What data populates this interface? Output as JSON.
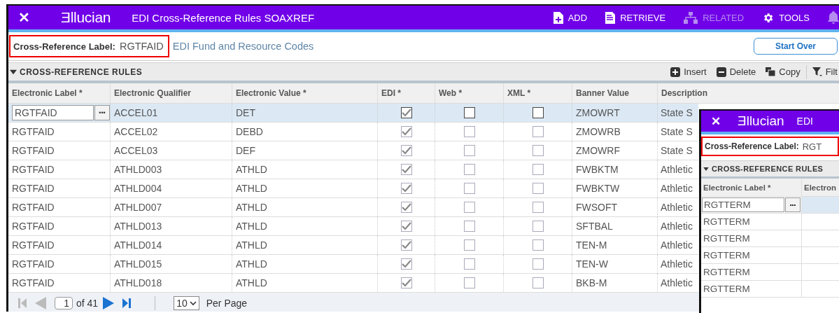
{
  "header": {
    "close": "✕",
    "logo": "Ǝllucian",
    "title": "EDI Cross-Reference Rules SOAXREF",
    "actions": [
      {
        "label": "ADD",
        "kind": "add",
        "disabled": false
      },
      {
        "label": "RETRIEVE",
        "kind": "retrieve",
        "disabled": false
      },
      {
        "label": "RELATED",
        "kind": "related",
        "disabled": true
      },
      {
        "label": "TOOLS",
        "kind": "tools",
        "disabled": false
      }
    ]
  },
  "key_block": {
    "label": "Cross-Reference Label:",
    "value": "RGTFAID",
    "description": "EDI Fund and Resource Codes",
    "start_over": "Start Over"
  },
  "section": {
    "title": "CROSS-REFERENCE RULES",
    "expanded": true,
    "tools": [
      {
        "label": "Insert",
        "kind": "insert"
      },
      {
        "label": "Delete",
        "kind": "delete"
      },
      {
        "label": "Copy",
        "kind": "copy"
      },
      {
        "label": "Filt",
        "kind": "filter"
      }
    ]
  },
  "table": {
    "columns": [
      "Electronic Label *",
      "Electronic Qualifier",
      "Electronic Value *",
      "EDI *",
      "Web *",
      "XML *",
      "Banner Value",
      "Description"
    ],
    "lookup": "•••",
    "rows": [
      {
        "selected": true,
        "label": "RGTFAID",
        "qualifier": "ACCEL01",
        "value": "DET",
        "edi": true,
        "web": false,
        "xml": false,
        "banner_value": "ZMOWRT",
        "description": "State S"
      },
      {
        "selected": false,
        "label": "RGTFAID",
        "qualifier": "ACCEL02",
        "value": "DEBD",
        "edi": true,
        "web": false,
        "xml": false,
        "banner_value": "ZMOWRB",
        "description": "State S"
      },
      {
        "selected": false,
        "label": "RGTFAID",
        "qualifier": "ACCEL03",
        "value": "DEF",
        "edi": true,
        "web": false,
        "xml": false,
        "banner_value": "ZMOWRF",
        "description": "State S"
      },
      {
        "selected": false,
        "label": "RGTFAID",
        "qualifier": "ATHLD003",
        "value": "ATHLD",
        "edi": true,
        "web": false,
        "xml": false,
        "banner_value": "FWBKTM",
        "description": "Athletic"
      },
      {
        "selected": false,
        "label": "RGTFAID",
        "qualifier": "ATHLD004",
        "value": "ATHLD",
        "edi": true,
        "web": false,
        "xml": false,
        "banner_value": "FWBKTW",
        "description": "Athletic"
      },
      {
        "selected": false,
        "label": "RGTFAID",
        "qualifier": "ATHLD007",
        "value": "ATHLD",
        "edi": true,
        "web": false,
        "xml": false,
        "banner_value": "FWSOFT",
        "description": "Athletic"
      },
      {
        "selected": false,
        "label": "RGTFAID",
        "qualifier": "ATHLD013",
        "value": "ATHLD",
        "edi": true,
        "web": false,
        "xml": false,
        "banner_value": "SFTBAL",
        "description": "Athletic"
      },
      {
        "selected": false,
        "label": "RGTFAID",
        "qualifier": "ATHLD014",
        "value": "ATHLD",
        "edi": true,
        "web": false,
        "xml": false,
        "banner_value": "TEN-M",
        "description": "Athletic"
      },
      {
        "selected": false,
        "label": "RGTFAID",
        "qualifier": "ATHLD015",
        "value": "ATHLD",
        "edi": true,
        "web": false,
        "xml": false,
        "banner_value": "TEN-W",
        "description": "Athletic"
      },
      {
        "selected": false,
        "label": "RGTFAID",
        "qualifier": "ATHLD018",
        "value": "ATHLD",
        "edi": true,
        "web": false,
        "xml": false,
        "banner_value": "BKB-M",
        "description": "Athletic"
      }
    ]
  },
  "pager": {
    "page": "1",
    "of": "of 41",
    "per_page": "10",
    "per_page_label": "Per Page"
  },
  "second_window": {
    "close": "✕",
    "logo": "Ǝllucian",
    "title": "EDI",
    "key_label": "Cross-Reference Label:",
    "key_value": "RGT",
    "section_title": "CROSS-REFERENCE RULES",
    "columns": [
      "Electronic Label *",
      "Electron"
    ],
    "lookup": "•••",
    "rows": [
      {
        "selected": true,
        "label": "RGTTERM"
      },
      {
        "selected": false,
        "label": "RGTTERM"
      },
      {
        "selected": false,
        "label": "RGTTERM"
      },
      {
        "selected": false,
        "label": "RGTTERM"
      },
      {
        "selected": false,
        "label": "RGTTERM"
      },
      {
        "selected": false,
        "label": "RGTTERM"
      }
    ]
  }
}
